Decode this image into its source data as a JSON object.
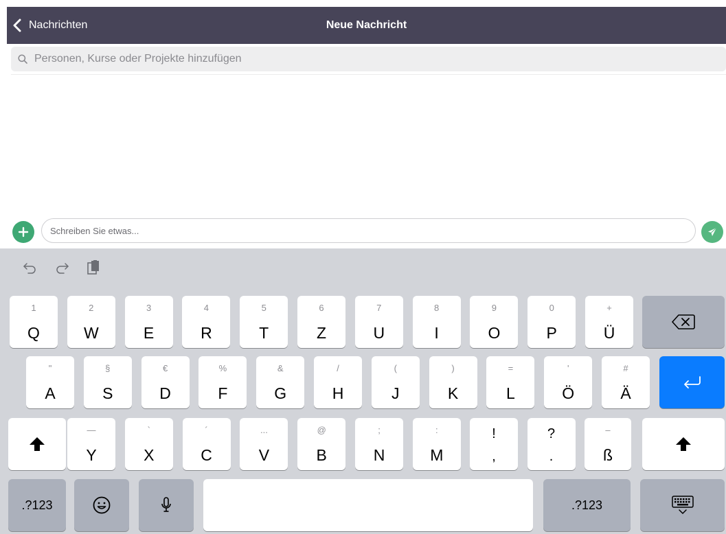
{
  "header": {
    "back_label": "Nachrichten",
    "title": "Neue Nachricht"
  },
  "search": {
    "placeholder": "Personen, Kurse oder Projekte hinzufügen",
    "value": ""
  },
  "compose": {
    "placeholder": "Schreiben Sie etwas...",
    "value": ""
  },
  "keyboard": {
    "row1": [
      {
        "alt": "1",
        "main": "Q"
      },
      {
        "alt": "2",
        "main": "W"
      },
      {
        "alt": "3",
        "main": "E"
      },
      {
        "alt": "4",
        "main": "R"
      },
      {
        "alt": "5",
        "main": "T"
      },
      {
        "alt": "6",
        "main": "Z"
      },
      {
        "alt": "7",
        "main": "U"
      },
      {
        "alt": "8",
        "main": "I"
      },
      {
        "alt": "9",
        "main": "O"
      },
      {
        "alt": "0",
        "main": "P"
      },
      {
        "alt": "+",
        "main": "Ü"
      }
    ],
    "row2": [
      {
        "alt": "\"",
        "main": "A"
      },
      {
        "alt": "§",
        "main": "S"
      },
      {
        "alt": "€",
        "main": "D"
      },
      {
        "alt": "%",
        "main": "F"
      },
      {
        "alt": "&",
        "main": "G"
      },
      {
        "alt": "/",
        "main": "H"
      },
      {
        "alt": "(",
        "main": "J"
      },
      {
        "alt": ")",
        "main": "K"
      },
      {
        "alt": "=",
        "main": "L"
      },
      {
        "alt": "'",
        "main": "Ö"
      },
      {
        "alt": "#",
        "main": "Ä"
      }
    ],
    "row3": [
      {
        "alt": "—",
        "main": "Y"
      },
      {
        "alt": "`",
        "main": "X"
      },
      {
        "alt": "´",
        "main": "C"
      },
      {
        "alt": "...",
        "main": "V"
      },
      {
        "alt": "@",
        "main": "B"
      },
      {
        "alt": ";",
        "main": "N"
      },
      {
        "alt": ":",
        "main": "M"
      }
    ],
    "punct": [
      {
        "top": "!",
        "bottom": ","
      },
      {
        "top": "?",
        "bottom": "."
      }
    ],
    "eszett": {
      "alt": "–",
      "main": "ß"
    },
    "numbers_label": ".?123",
    "icons": {
      "undo": "undo-icon",
      "redo": "redo-icon",
      "paste": "clipboard-icon",
      "backspace": "backspace-icon",
      "return": "return-icon",
      "shift": "shift-icon",
      "emoji": "emoji-icon",
      "mic": "microphone-icon",
      "hide": "keyboard-dismiss-icon"
    }
  },
  "colors": {
    "nav_bg": "#474458",
    "accent_green": "#3ea874",
    "return_key": "#0a7cff",
    "keyboard_bg": "#d2d4d9",
    "dark_key": "#abb0bb"
  }
}
